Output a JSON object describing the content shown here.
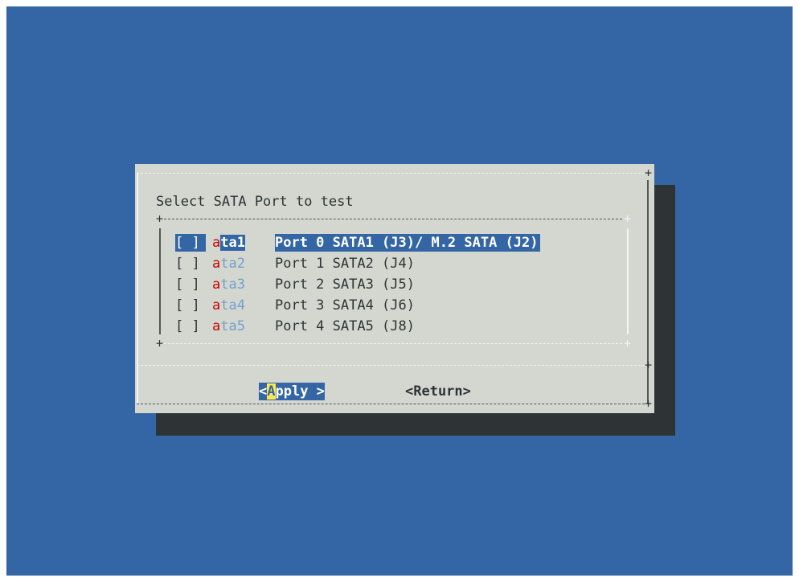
{
  "dialog": {
    "title": "Select SATA Port to test",
    "items": [
      {
        "checkbox": "[ ]",
        "tag_first": "a",
        "tag_rest": "ta1",
        "description": "Port 0 SATA1 (J3)/ M.2 SATA (J2)",
        "selected": true
      },
      {
        "checkbox": "[ ]",
        "tag_first": "a",
        "tag_rest": "ta2",
        "description": "Port 1 SATA2 (J4)",
        "selected": false
      },
      {
        "checkbox": "[ ]",
        "tag_first": "a",
        "tag_rest": "ta3",
        "description": "Port 2 SATA3 (J5)",
        "selected": false
      },
      {
        "checkbox": "[ ]",
        "tag_first": "a",
        "tag_rest": "ta4",
        "description": "Port 3 SATA4 (J6)",
        "selected": false
      },
      {
        "checkbox": "[ ]",
        "tag_first": "a",
        "tag_rest": "ta5",
        "description": "Port 4 SATA5 (J8)",
        "selected": false
      }
    ],
    "buttons": {
      "apply": {
        "prefix": "<",
        "hotkey": "A",
        "rest": "pply >"
      },
      "return": {
        "label": "<Return>"
      }
    }
  },
  "colors": {
    "background": "#3465a4",
    "dialog": "#d3d7cf",
    "shadow": "#2e3436",
    "highlight": "#3465a4",
    "hotkey": "#cc0000",
    "tag": "#729fcf",
    "button_hotkey": "#fce94f"
  }
}
